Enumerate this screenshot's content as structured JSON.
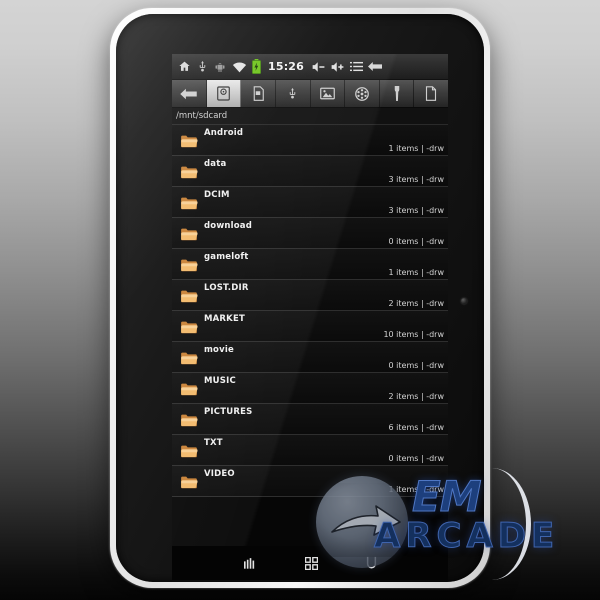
{
  "device": {
    "name": "android-tablet",
    "bezel_color": "#f2f2f2",
    "screen_color": "#060606"
  },
  "statusbar": {
    "icons": [
      {
        "name": "home-icon",
        "label": "Home"
      },
      {
        "name": "usb-icon",
        "label": "USB"
      },
      {
        "name": "android-robot-icon",
        "label": "Android"
      },
      {
        "name": "wifi-icon",
        "label": "Wi-Fi"
      },
      {
        "name": "battery-charging-icon",
        "label": "Battery charging"
      }
    ],
    "time": "15:26",
    "right_icons": [
      {
        "name": "volume-down-icon",
        "label": "Volume down"
      },
      {
        "name": "volume-up-icon",
        "label": "Volume up"
      },
      {
        "name": "menu-icon",
        "label": "Menu"
      },
      {
        "name": "back-arrow-icon",
        "label": "Back"
      }
    ],
    "battery_color": "#76d41f"
  },
  "toolbar": {
    "buttons": [
      {
        "name": "back-button",
        "icon": "back-arrow-icon",
        "label": "Back",
        "active": false
      },
      {
        "name": "storage-button",
        "icon": "internal-storage-icon",
        "label": "Internal storage",
        "active": true
      },
      {
        "name": "sdcard-button",
        "icon": "sdcard-icon",
        "label": "SD card",
        "active": false
      },
      {
        "name": "usb-button",
        "icon": "usb-icon",
        "label": "USB",
        "active": false
      },
      {
        "name": "pictures-button",
        "icon": "image-icon",
        "label": "Pictures",
        "active": false
      },
      {
        "name": "movies-button",
        "icon": "film-reel-icon",
        "label": "Movies",
        "active": false
      },
      {
        "name": "tools-button",
        "icon": "wrench-icon",
        "label": "Tools",
        "active": false
      },
      {
        "name": "documents-button",
        "icon": "document-icon",
        "label": "Documents",
        "active": false
      }
    ]
  },
  "pathbar": {
    "path": "/mnt/sdcard"
  },
  "filelist": {
    "folder_icon": "folder-icon",
    "meta_separator": "|",
    "permissions": "-drw",
    "items": [
      {
        "name": "Android",
        "items": "1 items",
        "perm": "-drw",
        "meta": "1 items | -drw"
      },
      {
        "name": "data",
        "items": "3 items",
        "perm": "-drw",
        "meta": "3 items | -drw"
      },
      {
        "name": "DCIM",
        "items": "3 items",
        "perm": "-drw",
        "meta": "3 items | -drw"
      },
      {
        "name": "download",
        "items": "0 items",
        "perm": "-drw",
        "meta": "0 items | -drw"
      },
      {
        "name": "gameloft",
        "items": "1 items",
        "perm": "-drw",
        "meta": "1 items | -drw"
      },
      {
        "name": "LOST.DIR",
        "items": "2 items",
        "perm": "-drw",
        "meta": "2 items | -drw"
      },
      {
        "name": "MARKET",
        "items": "10 items",
        "perm": "-drw",
        "meta": "10 items | -drw"
      },
      {
        "name": "movie",
        "items": "0 items",
        "perm": "-drw",
        "meta": "0 items | -drw"
      },
      {
        "name": "MUSIC",
        "items": "2 items",
        "perm": "-drw",
        "meta": "2 items | -drw"
      },
      {
        "name": "PICTURES",
        "items": "6 items",
        "perm": "-drw",
        "meta": "6 items | -drw"
      },
      {
        "name": "TXT",
        "items": "0 items",
        "perm": "-drw",
        "meta": "0 items | -drw"
      },
      {
        "name": "VIDEO",
        "items": "1 items",
        "perm": "-drw",
        "meta": "1 items | -drw"
      }
    ]
  },
  "navbar": {
    "buttons": [
      {
        "name": "signal-bars-icon",
        "label": "Signal"
      },
      {
        "name": "app-grid-icon",
        "label": "Apps"
      },
      {
        "name": "magnet-icon",
        "label": "U"
      }
    ]
  },
  "watermark": {
    "logo": "globe-arrow-icon",
    "title": "EM",
    "subtitle": "ARCADE",
    "color": "#2a53a8"
  }
}
